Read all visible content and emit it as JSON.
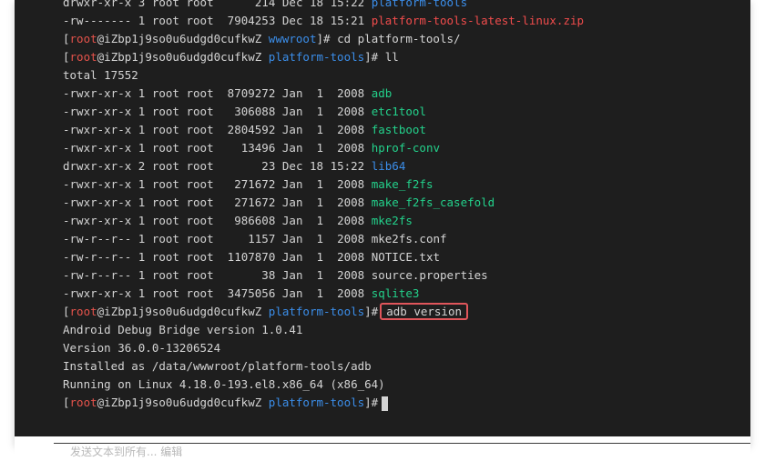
{
  "prompt": {
    "user": "root",
    "host": "iZbp1j9so0u6udgd0cufkwZ"
  },
  "lines": [
    {
      "type": "file",
      "perms": "drwxr-xr-x",
      "links": "3",
      "owner": "root",
      "group": "root",
      "size": "     214",
      "date": "Dec 18 15:22",
      "name": "platform-tools",
      "kind": "dir"
    },
    {
      "type": "file",
      "perms": "-rw-------",
      "links": "1",
      "owner": "root",
      "group": "root",
      "size": " 7904253",
      "date": "Dec 18 15:21",
      "name": "platform-tools-latest-linux.zip",
      "kind": "archive"
    },
    {
      "type": "prompt",
      "dir": "wwwroot",
      "cmd": "cd platform-tools/"
    },
    {
      "type": "prompt",
      "dir": "platform-tools",
      "cmd": "ll"
    },
    {
      "type": "text",
      "text": "total 17552"
    },
    {
      "type": "file",
      "perms": "-rwxr-xr-x",
      "links": "1",
      "owner": "root",
      "group": "root",
      "size": " 8709272",
      "date": "Jan  1  2008",
      "name": "adb",
      "kind": "exec"
    },
    {
      "type": "file",
      "perms": "-rwxr-xr-x",
      "links": "1",
      "owner": "root",
      "group": "root",
      "size": "  306088",
      "date": "Jan  1  2008",
      "name": "etc1tool",
      "kind": "exec"
    },
    {
      "type": "file",
      "perms": "-rwxr-xr-x",
      "links": "1",
      "owner": "root",
      "group": "root",
      "size": " 2804592",
      "date": "Jan  1  2008",
      "name": "fastboot",
      "kind": "exec"
    },
    {
      "type": "file",
      "perms": "-rwxr-xr-x",
      "links": "1",
      "owner": "root",
      "group": "root",
      "size": "   13496",
      "date": "Jan  1  2008",
      "name": "hprof-conv",
      "kind": "exec"
    },
    {
      "type": "file",
      "perms": "drwxr-xr-x",
      "links": "2",
      "owner": "root",
      "group": "root",
      "size": "      23",
      "date": "Dec 18 15:22",
      "name": "lib64",
      "kind": "dir"
    },
    {
      "type": "file",
      "perms": "-rwxr-xr-x",
      "links": "1",
      "owner": "root",
      "group": "root",
      "size": "  271672",
      "date": "Jan  1  2008",
      "name": "make_f2fs",
      "kind": "exec"
    },
    {
      "type": "file",
      "perms": "-rwxr-xr-x",
      "links": "1",
      "owner": "root",
      "group": "root",
      "size": "  271672",
      "date": "Jan  1  2008",
      "name": "make_f2fs_casefold",
      "kind": "exec"
    },
    {
      "type": "file",
      "perms": "-rwxr-xr-x",
      "links": "1",
      "owner": "root",
      "group": "root",
      "size": "  986608",
      "date": "Jan  1  2008",
      "name": "mke2fs",
      "kind": "exec"
    },
    {
      "type": "file",
      "perms": "-rw-r--r--",
      "links": "1",
      "owner": "root",
      "group": "root",
      "size": "    1157",
      "date": "Jan  1  2008",
      "name": "mke2fs.conf",
      "kind": "plain"
    },
    {
      "type": "file",
      "perms": "-rw-r--r--",
      "links": "1",
      "owner": "root",
      "group": "root",
      "size": " 1107870",
      "date": "Jan  1  2008",
      "name": "NOTICE.txt",
      "kind": "plain"
    },
    {
      "type": "file",
      "perms": "-rw-r--r--",
      "links": "1",
      "owner": "root",
      "group": "root",
      "size": "      38",
      "date": "Jan  1  2008",
      "name": "source.properties",
      "kind": "plain"
    },
    {
      "type": "file",
      "perms": "-rwxr-xr-x",
      "links": "1",
      "owner": "root",
      "group": "root",
      "size": " 3475056",
      "date": "Jan  1  2008",
      "name": "sqlite3",
      "kind": "exec"
    },
    {
      "type": "prompt",
      "dir": "platform-tools",
      "cmd": "adb version",
      "highlight": true
    },
    {
      "type": "text",
      "text": "Android Debug Bridge version 1.0.41"
    },
    {
      "type": "text",
      "text": "Version 36.0.0-13206524"
    },
    {
      "type": "text",
      "text": "Installed as /data/wwwroot/platform-tools/adb"
    },
    {
      "type": "text",
      "text": "Running on Linux 4.18.0-193.el8.x86_64 (x86_64)"
    },
    {
      "type": "prompt",
      "dir": "platform-tools",
      "cmd": "",
      "cursor": true
    }
  ],
  "status": {
    "hint": "发送文本到所有... 编辑"
  },
  "colors": {
    "background": "#1e1e1e",
    "text": "#d4d4d4",
    "exec": "#23d18b",
    "dir": "#3b8eea",
    "archive": "#f14c4c",
    "user": "#e5534b",
    "highlight": "#e0565b"
  }
}
